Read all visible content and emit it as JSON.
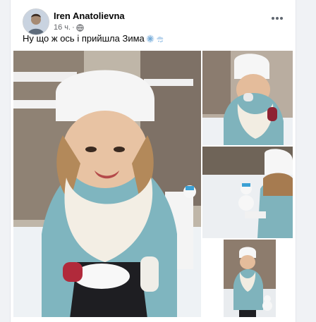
{
  "post": {
    "author": "Iren Anatolievna",
    "time": "16 ч.",
    "separator": "·",
    "text": "Ну що ж ось і прийшла Зима"
  },
  "icons": {
    "privacy": "globe-icon",
    "menu": "more-options-icon",
    "emoji": "snowflake-cloud-icon"
  },
  "colors": {
    "card_bg": "#ffffff",
    "page_bg": "#f0f2f5",
    "text_primary": "#050505",
    "text_secondary": "#65676b"
  }
}
